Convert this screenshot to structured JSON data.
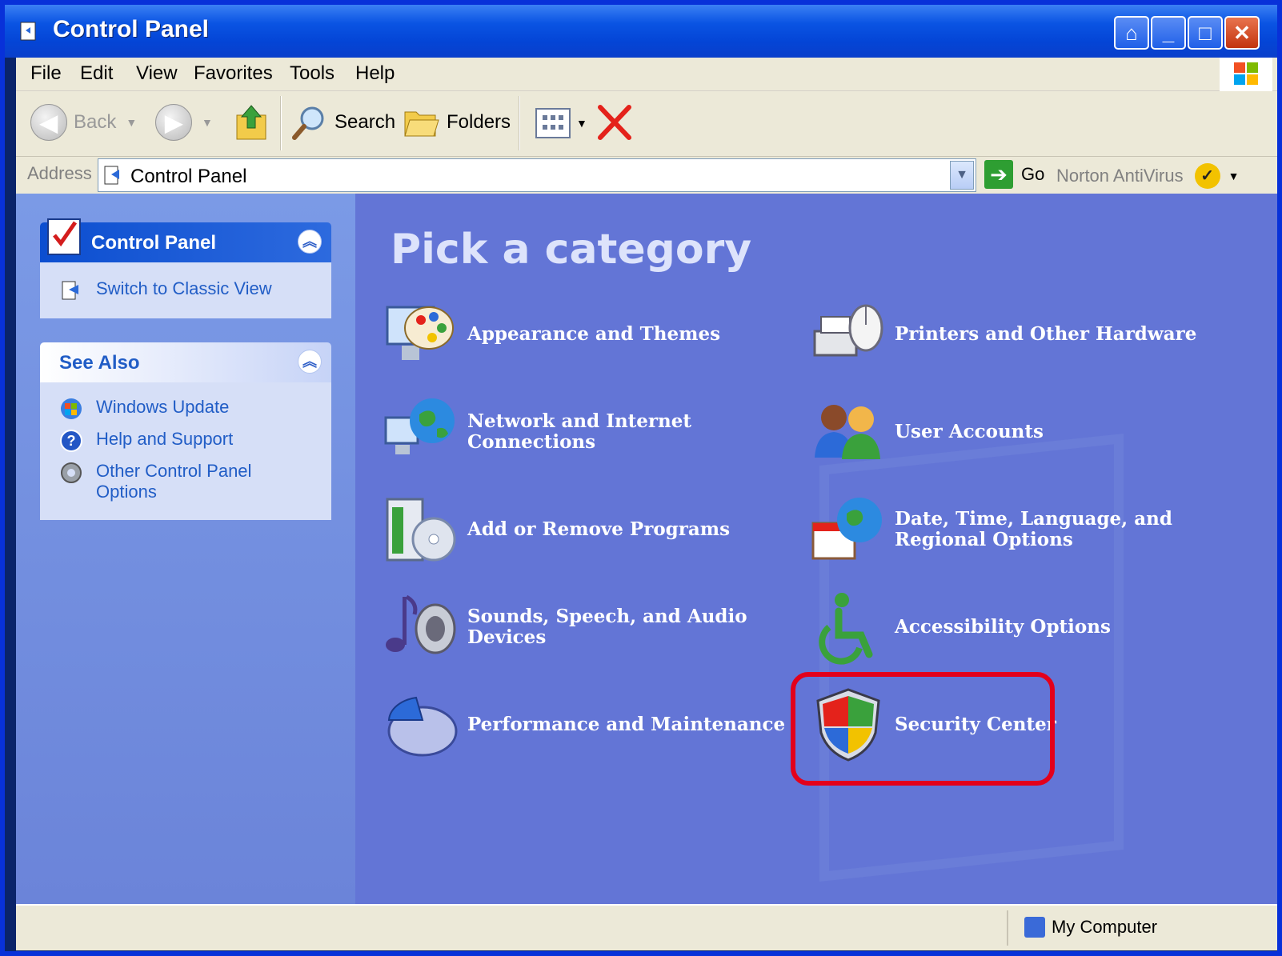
{
  "window": {
    "title": "Control Panel"
  },
  "title_buttons": [
    "help-icon",
    "minimize-icon",
    "maximize-icon",
    "close-icon"
  ],
  "menu": [
    "File",
    "Edit",
    "View",
    "Favorites",
    "Tools",
    "Help"
  ],
  "toolbar": {
    "back_label": "Back",
    "search_label": "Search",
    "folders_label": "Folders"
  },
  "address": {
    "label": "Address",
    "value": "Control Panel",
    "go_label": "Go",
    "norton_label": "Norton AntiVirus"
  },
  "left_pane": {
    "control_panel": {
      "title": "Control Panel",
      "link": "Switch to Classic View"
    },
    "see_also": {
      "title": "See Also",
      "links": [
        "Windows Update",
        "Help and Support",
        "Other Control Panel Options"
      ]
    }
  },
  "main": {
    "heading": "Pick a category",
    "categories": [
      "Appearance and Themes",
      "Printers and Other Hardware",
      "Network and Internet Connections",
      "User Accounts",
      "Add or Remove Programs",
      "Date, Time, Language, and Regional Options",
      "Sounds, Speech, and Audio Devices",
      "Accessibility Options",
      "Performance and Maintenance",
      "Security Center"
    ],
    "highlighted": "Security Center"
  },
  "status": {
    "zone": "My Computer"
  },
  "colors": {
    "highlight": "#e3001b",
    "main_bg": "#6375d6",
    "title_bar": "#0a54e3"
  }
}
